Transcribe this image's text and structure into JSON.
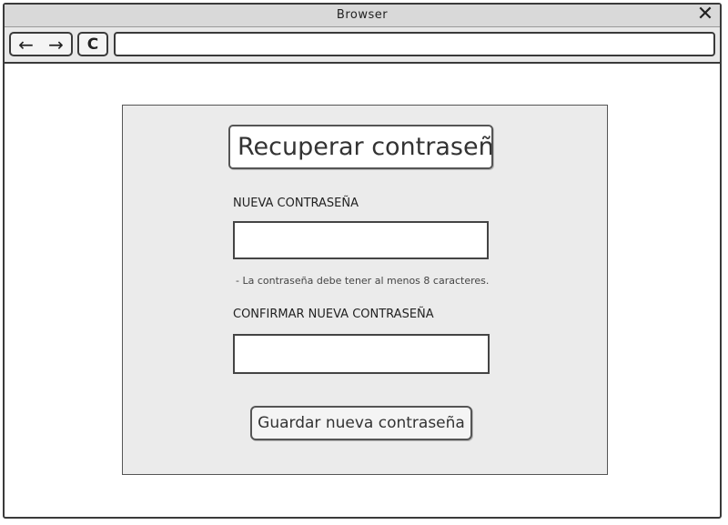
{
  "window": {
    "title": "Browser",
    "close_icon": "close-icon"
  },
  "toolbar": {
    "back_glyph": "←",
    "forward_glyph": "→",
    "reload_glyph": "C",
    "address_value": ""
  },
  "form": {
    "heading": "Recuperar contraseña",
    "new_password_label": "NUEVA CONTRASEÑA",
    "new_password_value": "",
    "hint": "- La contraseña debe tener al menos 8 caracteres.",
    "confirm_password_label": "CONFIRMAR NUEVA CONTRASEÑA",
    "confirm_password_value": "",
    "save_button_label": "Guardar nueva contraseña"
  }
}
